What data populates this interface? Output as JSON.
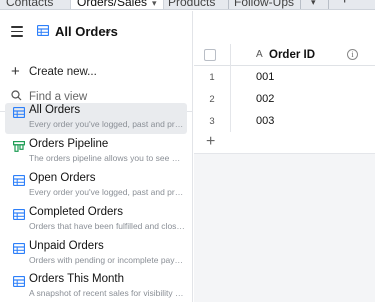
{
  "tabs": [
    {
      "label": "Contacts",
      "active": false
    },
    {
      "label": "Orders/Sales",
      "active": true
    },
    {
      "label": "Products",
      "active": false
    },
    {
      "label": "Follow-Ups",
      "active": false
    }
  ],
  "header": {
    "view_title": "All Orders"
  },
  "sidebar": {
    "create_label": "Create new...",
    "find_placeholder": "Find a view",
    "views": [
      {
        "name": "All Orders",
        "desc": "Every order you've logged, past and present",
        "icon": "grid-icon",
        "selected": true
      },
      {
        "name": "Orders Pipeline",
        "desc": "The orders pipeline allows you to see which orders",
        "icon": "kanban-icon",
        "selected": false
      },
      {
        "name": "Open Orders",
        "desc": "Every order you've logged, past and present",
        "icon": "grid-icon",
        "selected": false
      },
      {
        "name": "Completed Orders",
        "desc": "Orders that have been fulfilled and closed out",
        "icon": "grid-icon",
        "selected": false
      },
      {
        "name": "Unpaid Orders",
        "desc": "Orders with pending or incomplete payments",
        "icon": "grid-icon",
        "selected": false
      },
      {
        "name": "Orders This Month",
        "desc": "A snapshot of recent sales for visibility into trends",
        "icon": "grid-icon",
        "selected": false
      }
    ]
  },
  "grid": {
    "column_title": "Order ID",
    "rows": [
      {
        "num": "1",
        "value": "001"
      },
      {
        "num": "2",
        "value": "002"
      },
      {
        "num": "3",
        "value": "003"
      }
    ]
  },
  "colors": {
    "accent": "#2d7ff9",
    "selected_bg": "#e9ebee",
    "kanban_green": "#1f9d55"
  }
}
